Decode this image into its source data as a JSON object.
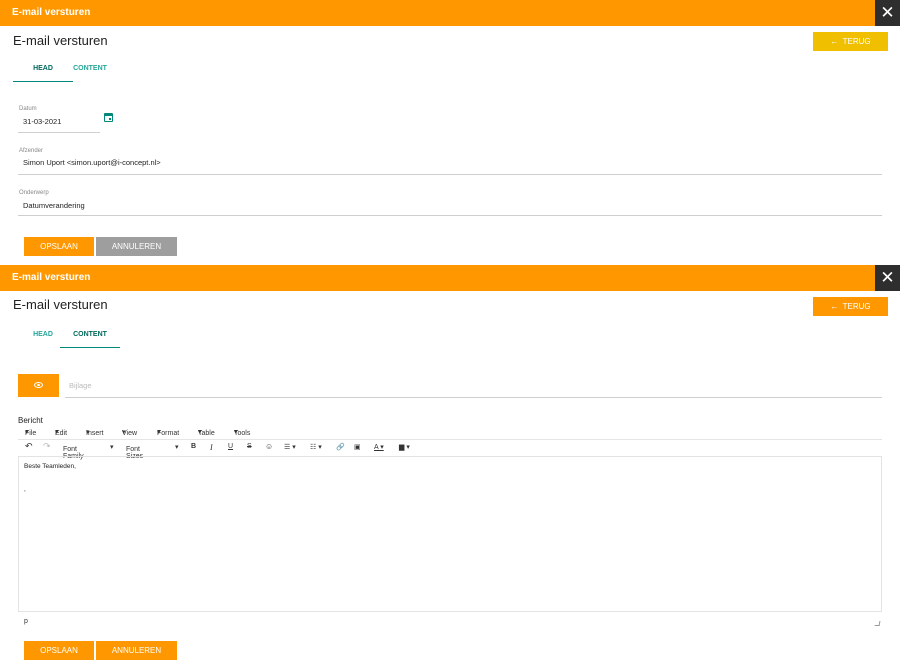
{
  "window": {
    "title": "E-mail versturen",
    "close_icon": "close-icon"
  },
  "page_title": "E-mail versturen",
  "back_button": {
    "label": "TERUG",
    "icon": "arrow-left-icon"
  },
  "tabs": [
    {
      "label": "HEAD"
    },
    {
      "label": "CONTENT"
    }
  ],
  "head_form": {
    "datum": {
      "label": "Datum",
      "value": "31-03-2021"
    },
    "afzender": {
      "label": "Afzender",
      "value": "Simon Uport <simon.uport@i-concept.nl>"
    },
    "onderwerp": {
      "label": "Onderwerp",
      "value": "Datumverandering"
    }
  },
  "content_form": {
    "bijlage_placeholder": "Bijlage",
    "bericht_label": "Bericht",
    "menu": [
      "File",
      "Edit",
      "Insert",
      "View",
      "Format",
      "Table",
      "Tools"
    ],
    "toolbar": {
      "font_family": "Font Family",
      "font_sizes": "Font Sizes"
    },
    "editor_lines": [
      "Beste Teamleden,",
      ","
    ],
    "status_path": "p"
  },
  "actions": {
    "save": "OPSLAAN",
    "cancel": "ANNULEREN"
  },
  "colors": {
    "accent": "#ff9800",
    "terug_inactive": "#f0c000",
    "tab_active": "#00897b",
    "cancel_disabled": "#9e9e9e"
  }
}
